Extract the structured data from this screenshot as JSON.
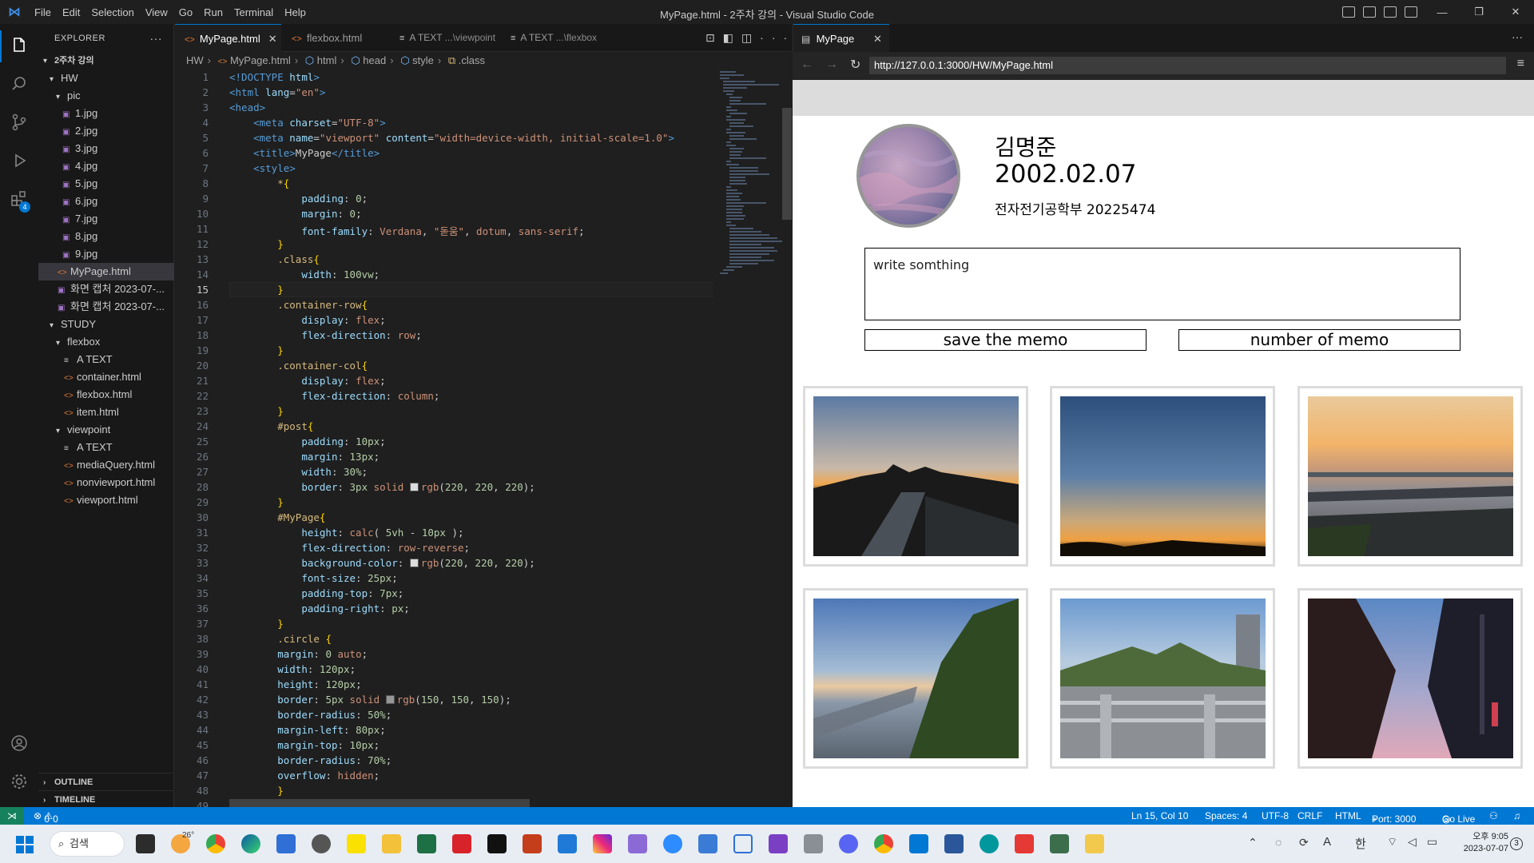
{
  "window": {
    "title": "MyPage.html - 2주차 강의 - Visual Studio Code",
    "menu": [
      "File",
      "Edit",
      "Selection",
      "View",
      "Go",
      "Run",
      "Terminal",
      "Help"
    ]
  },
  "sidebar": {
    "header": "EXPLORER",
    "root": "2주차 강의",
    "items": [
      {
        "label": "HW"
      },
      {
        "label": "pic"
      },
      {
        "label": "1.jpg"
      },
      {
        "label": "2.jpg"
      },
      {
        "label": "3.jpg"
      },
      {
        "label": "4.jpg"
      },
      {
        "label": "5.jpg"
      },
      {
        "label": "6.jpg"
      },
      {
        "label": "7.jpg"
      },
      {
        "label": "8.jpg"
      },
      {
        "label": "9.jpg"
      },
      {
        "label": "MyPage.html"
      },
      {
        "label": "화면 캡처 2023-07-..."
      },
      {
        "label": "화면 캡처 2023-07-..."
      },
      {
        "label": "STUDY"
      },
      {
        "label": "flexbox"
      },
      {
        "label": "A TEXT"
      },
      {
        "label": "container.html"
      },
      {
        "label": "flexbox.html"
      },
      {
        "label": "item.html"
      },
      {
        "label": "viewpoint"
      },
      {
        "label": "A TEXT"
      },
      {
        "label": "mediaQuery.html"
      },
      {
        "label": "nonviewport.html"
      },
      {
        "label": "viewport.html"
      }
    ],
    "outline": "OUTLINE",
    "timeline": "TIMELINE"
  },
  "editor": {
    "tabs": [
      {
        "label": "MyPage.html"
      },
      {
        "label": "flexbox.html"
      },
      {
        "label": "A TEXT",
        "sub": "...\\viewpoint"
      },
      {
        "label": "A TEXT",
        "sub": "...\\flexbox"
      }
    ],
    "breadcrumb": [
      "HW",
      "MyPage.html",
      "html",
      "head",
      "style",
      ".class"
    ],
    "line_numbers": [
      "1",
      "2",
      "3",
      "4",
      "5",
      "6",
      "7",
      "8",
      "9",
      "10",
      "11",
      "12",
      "13",
      "14",
      "15",
      "16",
      "17",
      "18",
      "19",
      "20",
      "21",
      "22",
      "23",
      "24",
      "25",
      "26",
      "27",
      "28",
      "29",
      "30",
      "31",
      "32",
      "33",
      "34",
      "35",
      "36",
      "37",
      "38",
      "39",
      "40",
      "41",
      "42",
      "43",
      "44",
      "45",
      "46",
      "47",
      "48",
      "49"
    ]
  },
  "browser": {
    "tab": "MyPage",
    "url": "http://127.0.0.1:3000/HW/MyPage.html",
    "page": {
      "name": "김명준",
      "birth": "2002.02.07",
      "info": "전자전기공학부 20225474",
      "memo_text": "write somthing",
      "save_button": "save the memo",
      "count_button": "number of memo"
    }
  },
  "statusbar": {
    "errors": "0",
    "warnings": "0",
    "position": "Ln 15, Col 10",
    "spaces": "Spaces: 4",
    "encoding": "UTF-8",
    "eol": "CRLF",
    "language": "HTML",
    "port": "Port: 3000",
    "golive": "Go Live"
  },
  "taskbar": {
    "search": "검색",
    "weather": "26°",
    "lang": "한",
    "time": "오후 9:05",
    "date": "2023-07-07",
    "notif": "3"
  }
}
